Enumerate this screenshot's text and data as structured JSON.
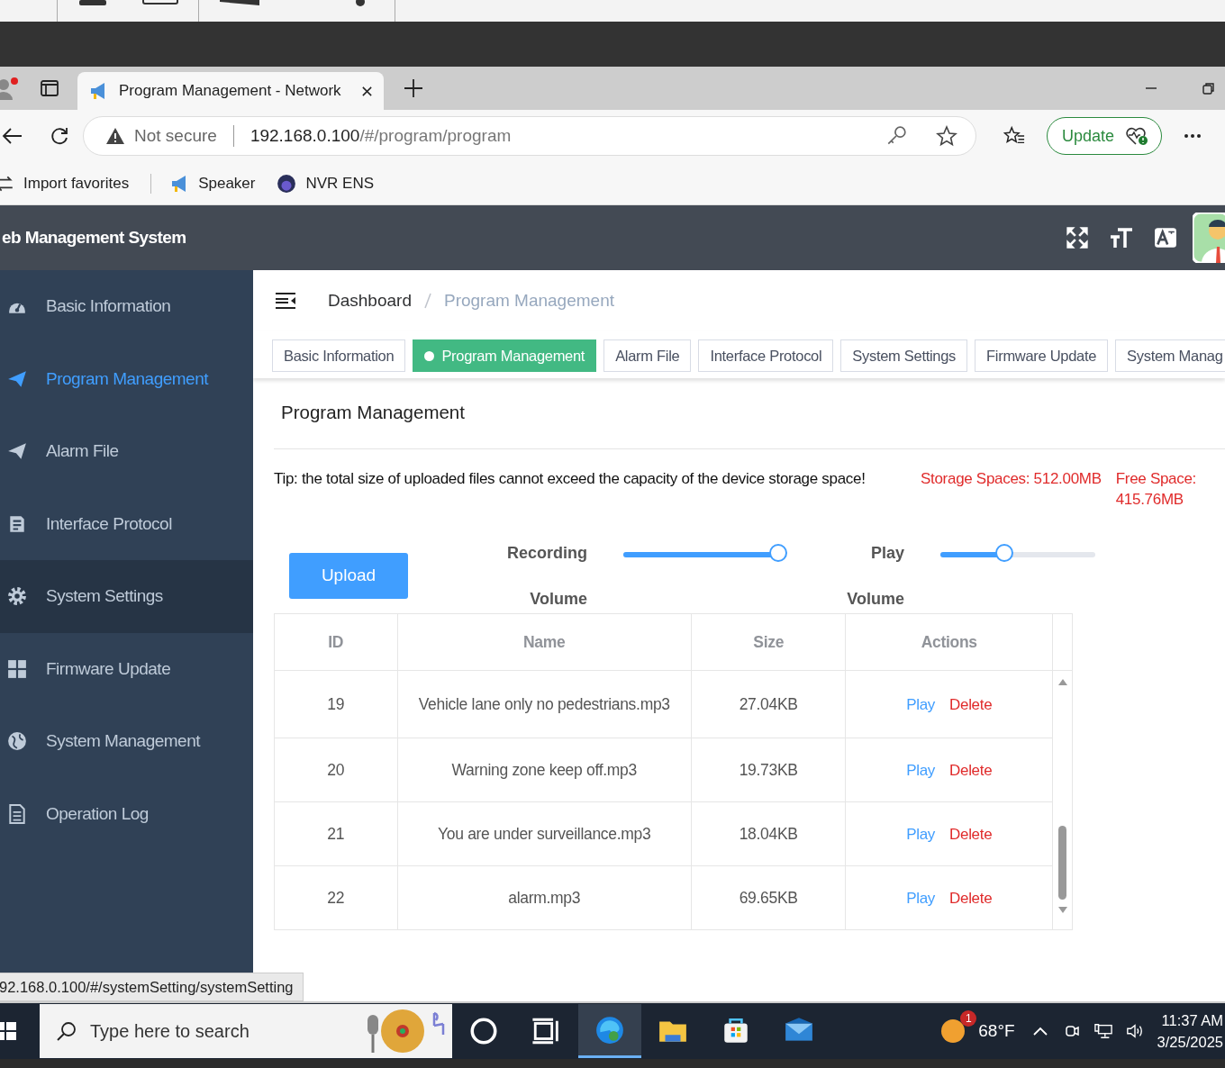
{
  "browser": {
    "tabs": [
      {
        "title": "Program Management - Network",
        "selected": true
      }
    ],
    "address": {
      "security": "Not secure",
      "host": "192.168.0.100",
      "path": "/#/program/program"
    },
    "update_button": "Update",
    "favorites": [
      {
        "label": "Import favorites",
        "kind": "import"
      },
      {
        "label": "Speaker",
        "kind": "megaphone"
      },
      {
        "label": "NVR ENS",
        "kind": "orb"
      }
    ],
    "status_url": "92.168.0.100/#/systemSetting/systemSetting"
  },
  "app": {
    "title": "eb Management System"
  },
  "sidebar": {
    "items": [
      {
        "label": "Basic Information",
        "kind": "dashboard",
        "selected": false,
        "hovered": false
      },
      {
        "label": "Program Management",
        "kind": "send",
        "selected": true,
        "hovered": false
      },
      {
        "label": "Alarm File",
        "kind": "send",
        "selected": false,
        "hovered": false
      },
      {
        "label": "Interface Protocol",
        "kind": "document",
        "selected": false,
        "hovered": false
      },
      {
        "label": "System Settings",
        "kind": "gear",
        "selected": false,
        "hovered": true
      },
      {
        "label": "Firmware Update",
        "kind": "grid",
        "selected": false,
        "hovered": false
      },
      {
        "label": "System Management",
        "kind": "globe",
        "selected": false,
        "hovered": false
      },
      {
        "label": "Operation Log",
        "kind": "log",
        "selected": false,
        "hovered": false
      }
    ]
  },
  "breadcrumb": [
    {
      "label": "Dashboard",
      "current": false
    },
    {
      "label": "Program Management",
      "current": true
    }
  ],
  "tags": [
    {
      "label": "Basic Information",
      "selected": false
    },
    {
      "label": "Program Management",
      "selected": true
    },
    {
      "label": "Alarm File",
      "selected": false
    },
    {
      "label": "Interface Protocol",
      "selected": false
    },
    {
      "label": "System Settings",
      "selected": false
    },
    {
      "label": "Firmware Update",
      "selected": false
    },
    {
      "label": "System Manag",
      "selected": false
    }
  ],
  "panel": {
    "title": "Program Management",
    "tip": "Tip: the total size of uploaded files cannot exceed the capacity of the device storage space!",
    "storage": "Storage Spaces: 512.00MB",
    "free_space": "Free Space: 415.76MB",
    "upload_button": "Upload",
    "sliders": [
      {
        "label": "Recording Volume",
        "level": 1.0
      },
      {
        "label": "Play Volume",
        "level": 0.41
      }
    ]
  },
  "table": {
    "columns": [
      "ID",
      "Name",
      "Size",
      "Actions"
    ],
    "rows": [
      {
        "id": "19",
        "name": "Vehicle lane only no pedestrians.mp3",
        "size": "27.04KB",
        "actions": [
          "Play",
          "Delete"
        ]
      },
      {
        "id": "20",
        "name": "Warning zone keep off.mp3",
        "size": "19.73KB",
        "actions": [
          "Play",
          "Delete"
        ]
      },
      {
        "id": "21",
        "name": "You are under surveillance.mp3",
        "size": "18.04KB",
        "actions": [
          "Play",
          "Delete"
        ]
      },
      {
        "id": "22",
        "name": "alarm.mp3",
        "size": "69.65KB",
        "actions": [
          "Play",
          "Delete"
        ]
      }
    ]
  },
  "taskbar": {
    "search_placeholder": "Type here to search",
    "apps": [
      {
        "kind": "cortana",
        "selected": false
      },
      {
        "kind": "taskview",
        "selected": false
      },
      {
        "kind": "edge",
        "selected": true
      },
      {
        "kind": "folder",
        "selected": false
      },
      {
        "kind": "store",
        "selected": false
      },
      {
        "kind": "mail",
        "selected": false
      }
    ],
    "weather_badge": "1",
    "temperature": "68°F",
    "time": "11:37 AM",
    "date": "3/25/2025"
  }
}
